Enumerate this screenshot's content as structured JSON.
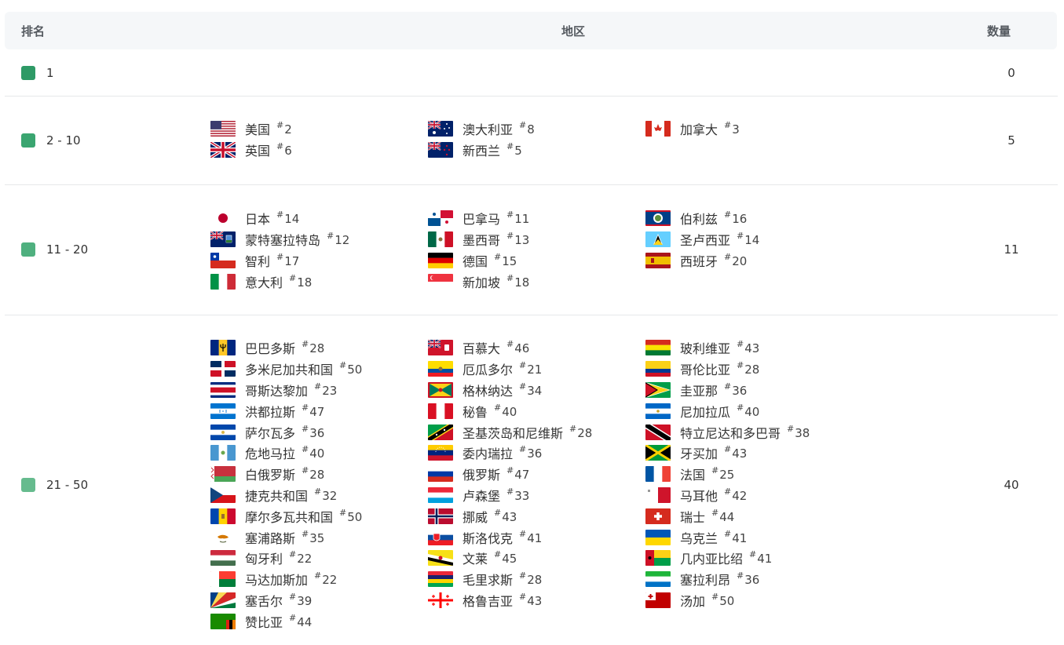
{
  "header": {
    "rank": "排名",
    "region": "地区",
    "count": "数量"
  },
  "groups": [
    {
      "rank": "1",
      "count": "0",
      "color": "#2e9a66",
      "columns": [
        [],
        [],
        []
      ]
    },
    {
      "rank": "2 - 10",
      "count": "5",
      "color": "#3aa570",
      "columns": [
        [
          {
            "name": "美国",
            "rank": "2",
            "flag": "us"
          },
          {
            "name": "英国",
            "rank": "6",
            "flag": "gb"
          }
        ],
        [
          {
            "name": "澳大利亚",
            "rank": "8",
            "flag": "au"
          },
          {
            "name": "新西兰",
            "rank": "5",
            "flag": "nz"
          }
        ],
        [
          {
            "name": "加拿大",
            "rank": "3",
            "flag": "ca"
          }
        ]
      ]
    },
    {
      "rank": "11 - 20",
      "count": "11",
      "color": "#4fb07f",
      "columns": [
        [
          {
            "name": "日本",
            "rank": "14",
            "flag": "jp"
          },
          {
            "name": "蒙特塞拉特岛",
            "rank": "12",
            "flag": "ms"
          },
          {
            "name": "智利",
            "rank": "17",
            "flag": "cl"
          },
          {
            "name": "意大利",
            "rank": "18",
            "flag": "it"
          }
        ],
        [
          {
            "name": "巴拿马",
            "rank": "11",
            "flag": "pa"
          },
          {
            "name": "墨西哥",
            "rank": "13",
            "flag": "mx"
          },
          {
            "name": "德国",
            "rank": "15",
            "flag": "de"
          },
          {
            "name": "新加坡",
            "rank": "18",
            "flag": "sg"
          }
        ],
        [
          {
            "name": "伯利兹",
            "rank": "16",
            "flag": "bz"
          },
          {
            "name": "圣卢西亚",
            "rank": "14",
            "flag": "lc"
          },
          {
            "name": "西班牙",
            "rank": "20",
            "flag": "es"
          }
        ]
      ]
    },
    {
      "rank": "21 - 50",
      "count": "40",
      "color": "#66bb8e",
      "columns": [
        [
          {
            "name": "巴巴多斯",
            "rank": "28",
            "flag": "bb"
          },
          {
            "name": "多米尼加共和国",
            "rank": "50",
            "flag": "do"
          },
          {
            "name": "哥斯达黎加",
            "rank": "23",
            "flag": "cr"
          },
          {
            "name": "洪都拉斯",
            "rank": "47",
            "flag": "hn"
          },
          {
            "name": "萨尔瓦多",
            "rank": "36",
            "flag": "sv"
          },
          {
            "name": "危地马拉",
            "rank": "40",
            "flag": "gt"
          },
          {
            "name": "白俄罗斯",
            "rank": "28",
            "flag": "by"
          },
          {
            "name": "捷克共和国",
            "rank": "32",
            "flag": "cz"
          },
          {
            "name": "摩尔多瓦共和国",
            "rank": "50",
            "flag": "md"
          },
          {
            "name": "塞浦路斯",
            "rank": "35",
            "flag": "cy"
          },
          {
            "name": "匈牙利",
            "rank": "22",
            "flag": "hu"
          },
          {
            "name": "马达加斯加",
            "rank": "22",
            "flag": "mg"
          },
          {
            "name": "塞舌尔",
            "rank": "39",
            "flag": "sc"
          },
          {
            "name": "赞比亚",
            "rank": "44",
            "flag": "zm"
          }
        ],
        [
          {
            "name": "百慕大",
            "rank": "46",
            "flag": "bm"
          },
          {
            "name": "厄瓜多尔",
            "rank": "21",
            "flag": "ec"
          },
          {
            "name": "格林纳达",
            "rank": "34",
            "flag": "gd"
          },
          {
            "name": "秘鲁",
            "rank": "40",
            "flag": "pe"
          },
          {
            "name": "圣基茨岛和尼维斯",
            "rank": "28",
            "flag": "kn"
          },
          {
            "name": "委内瑞拉",
            "rank": "36",
            "flag": "ve"
          },
          {
            "name": "俄罗斯",
            "rank": "47",
            "flag": "ru"
          },
          {
            "name": "卢森堡",
            "rank": "33",
            "flag": "lu"
          },
          {
            "name": "挪威",
            "rank": "43",
            "flag": "no"
          },
          {
            "name": "斯洛伐克",
            "rank": "41",
            "flag": "sk"
          },
          {
            "name": "文莱",
            "rank": "45",
            "flag": "bn"
          },
          {
            "name": "毛里求斯",
            "rank": "28",
            "flag": "mu"
          },
          {
            "name": "格鲁吉亚",
            "rank": "43",
            "flag": "ge"
          }
        ],
        [
          {
            "name": "玻利维亚",
            "rank": "43",
            "flag": "bo"
          },
          {
            "name": "哥伦比亚",
            "rank": "28",
            "flag": "co"
          },
          {
            "name": "圭亚那",
            "rank": "36",
            "flag": "gy"
          },
          {
            "name": "尼加拉瓜",
            "rank": "40",
            "flag": "ni"
          },
          {
            "name": "特立尼达和多巴哥",
            "rank": "38",
            "flag": "tt"
          },
          {
            "name": "牙买加",
            "rank": "43",
            "flag": "jm"
          },
          {
            "name": "法国",
            "rank": "25",
            "flag": "fr"
          },
          {
            "name": "马耳他",
            "rank": "42",
            "flag": "mt"
          },
          {
            "name": "瑞士",
            "rank": "44",
            "flag": "ch"
          },
          {
            "name": "乌克兰",
            "rank": "41",
            "flag": "ua"
          },
          {
            "name": "几内亚比绍",
            "rank": "41",
            "flag": "gw"
          },
          {
            "name": "塞拉利昂",
            "rank": "36",
            "flag": "sl"
          },
          {
            "name": "汤加",
            "rank": "50",
            "flag": "to"
          }
        ]
      ]
    }
  ]
}
